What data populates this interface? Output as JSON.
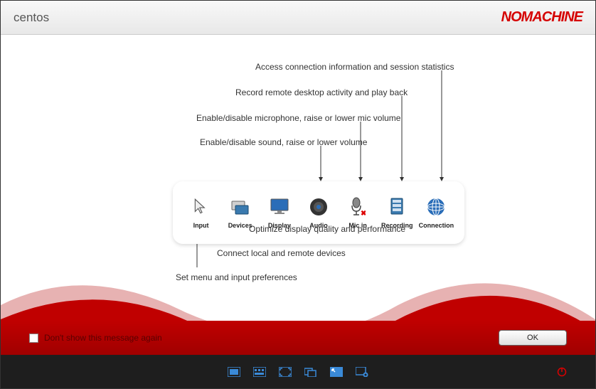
{
  "header": {
    "title": "centos",
    "brand": "NOMACHINE"
  },
  "toolbar": {
    "items": [
      {
        "label": "Input"
      },
      {
        "label": "Devices"
      },
      {
        "label": "Display"
      },
      {
        "label": "Audio"
      },
      {
        "label": "Mic in"
      },
      {
        "label": "Recording"
      },
      {
        "label": "Connection"
      }
    ]
  },
  "annotations": {
    "connection": "Access connection information and session statistics",
    "recording": "Record remote desktop activity and play back",
    "micin": "Enable/disable microphone, raise or lower mic volume",
    "audio": "Enable/disable sound, raise or lower volume",
    "display": "Optimize display quality and performance",
    "devices": "Connect local and remote devices",
    "input": "Set menu and input preferences"
  },
  "footer": {
    "checkbox_label": "Don't show this message again",
    "ok_label": "OK"
  }
}
